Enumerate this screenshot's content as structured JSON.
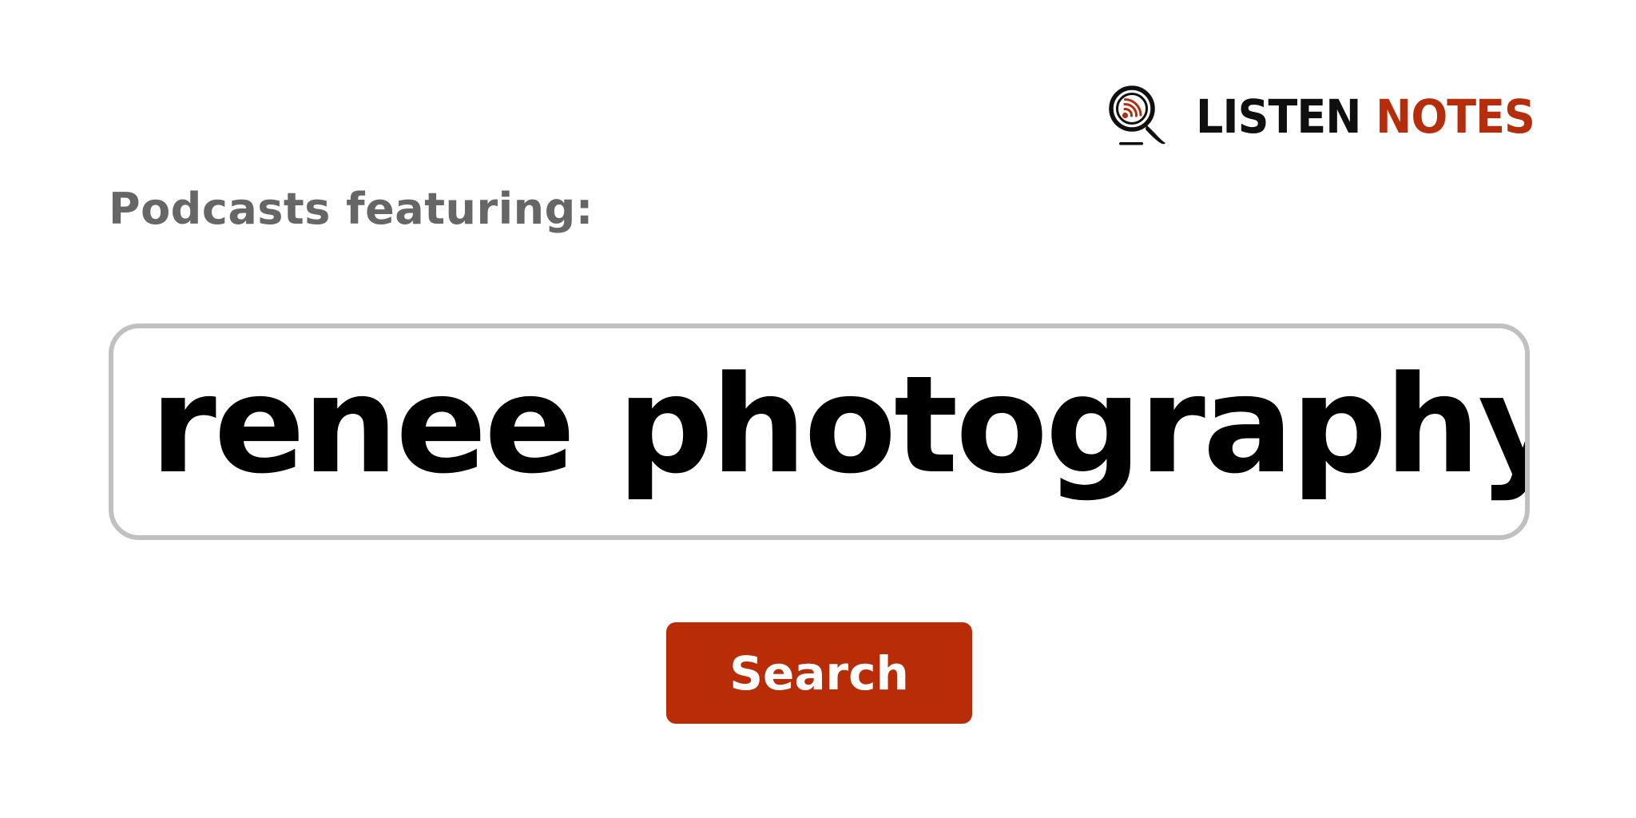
{
  "logo": {
    "word_1": "LISTEN",
    "word_2": "NOTES",
    "icon": "magnifier-podcast-icon",
    "colors": {
      "dark": "#0f0f0f",
      "accent": "#b52d0b"
    }
  },
  "heading": {
    "text": "Podcasts featuring:",
    "color": "#666666"
  },
  "search": {
    "value": "renee photography",
    "border_color": "#c0c0c0"
  },
  "search_button": {
    "label": "Search",
    "color": "#b82c06"
  }
}
